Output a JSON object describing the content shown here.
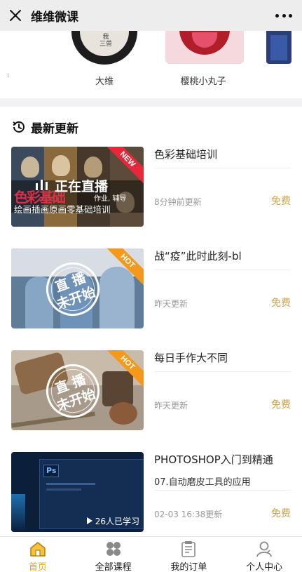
{
  "app": {
    "title": "维维微课"
  },
  "authors": [
    {
      "name": ""
    },
    {
      "name": "大维",
      "avatar_text": "我\n三兽"
    },
    {
      "name": "樱桃小丸子"
    },
    {
      "name": ""
    }
  ],
  "section": {
    "title": "最新更新"
  },
  "courses": [
    {
      "title": "色彩基础培训",
      "subtitle": "",
      "updated": "8分钟前更新",
      "price": "免费",
      "ribbon": "NEW",
      "ribbon_color": "#e5283a",
      "overlay_live": "正在直播",
      "overlay_text": "绘画插画原画零基础培训",
      "overlay_tag": "作业, 辅导",
      "overlay_big": "色彩基础"
    },
    {
      "title": "战“疫”此时此刻-bl",
      "subtitle": "",
      "updated": "昨天更新",
      "price": "免费",
      "ribbon": "HOT",
      "ribbon_color": "#f39a1e",
      "stamp_top": "直 播",
      "stamp_bottom": "未开始"
    },
    {
      "title": "每日手作大不同",
      "subtitle": "",
      "updated": "昨天更新",
      "price": "免费",
      "ribbon": "HOT",
      "ribbon_color": "#f39a1e",
      "stamp_top": "直 播",
      "stamp_bottom": "未开始"
    },
    {
      "title": "PHOTOSHOP入门到精通",
      "subtitle": "07.自动磨皮工具的应用",
      "updated": "02-03 16:38更新",
      "price": "免费",
      "learners": "26人已学习",
      "ps_label": "Ps"
    }
  ],
  "tabs": [
    {
      "label": "首页",
      "icon": "home-icon",
      "active": true
    },
    {
      "label": "全部课程",
      "icon": "grid-icon",
      "active": false
    },
    {
      "label": "我的订单",
      "icon": "order-icon",
      "active": false
    },
    {
      "label": "个人中心",
      "icon": "user-icon",
      "active": false
    }
  ],
  "colors": {
    "accent": "#e4a715",
    "price": "#c9a24a",
    "new": "#e5283a",
    "hot": "#f39a1e"
  }
}
